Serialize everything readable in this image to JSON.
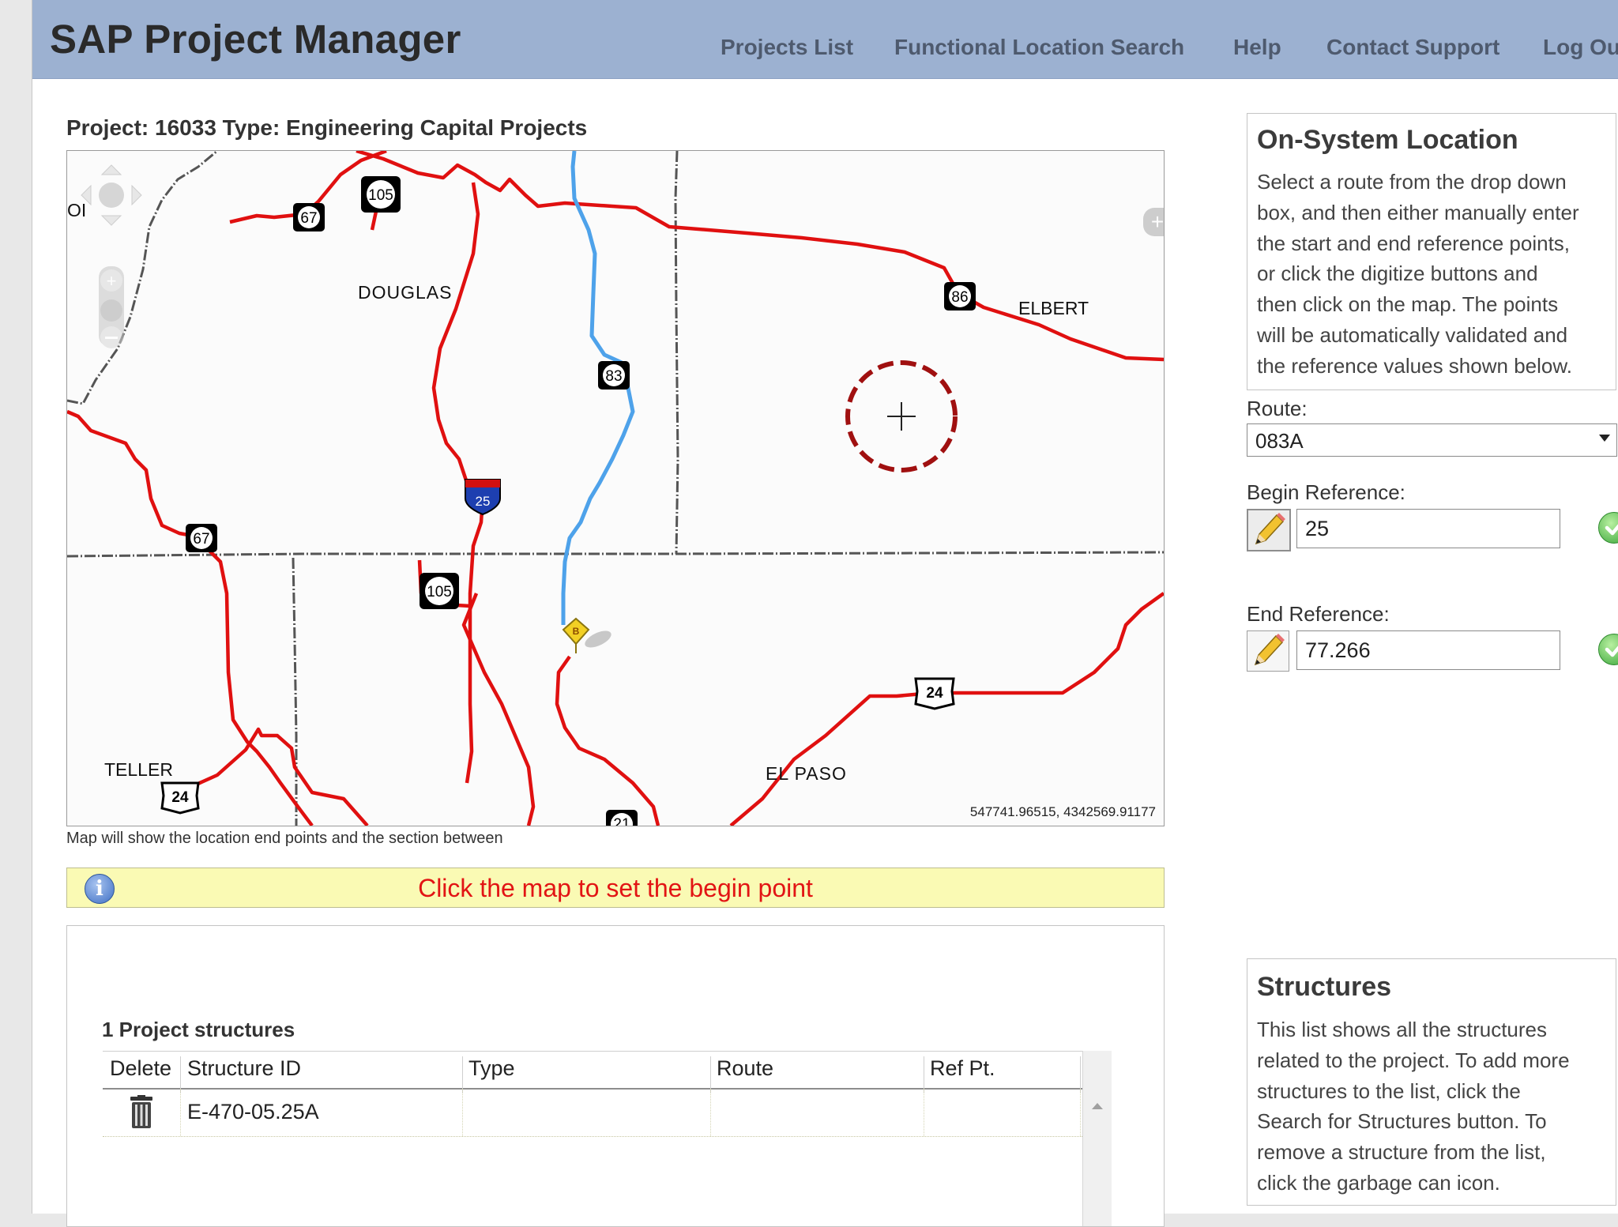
{
  "header": {
    "app_title": "SAP Project Manager",
    "nav": [
      "Projects List",
      "Functional Location Search",
      "Help",
      "Contact Support",
      "Log Ou"
    ]
  },
  "project": {
    "title": "Project: 16033 Type: Engineering Capital Projects"
  },
  "map": {
    "county_labels": [
      "DOUGLAS",
      "ELBERT",
      "TELLER",
      "EL PASO"
    ],
    "edge_label_left": "OI",
    "route_shields": [
      "105",
      "67",
      "86",
      "25",
      "67",
      "105",
      "24",
      "24",
      "21",
      "83"
    ],
    "begin_marker_label": "B",
    "coordinates": "547741.96515, 4342569.91177",
    "caption": "Map will show the location end points and the section between"
  },
  "info_bar": {
    "message": "Click the map to set the begin point"
  },
  "structures_table": {
    "count_label": "1 Project structures",
    "columns": [
      "Delete",
      "Structure ID",
      "Type",
      "Route",
      "Ref Pt."
    ],
    "rows": [
      {
        "structure_id": "E-470-05.25A",
        "type": "",
        "route": "",
        "ref_pt": ""
      }
    ]
  },
  "on_system_location": {
    "title": "On-System Location",
    "help_lines": [
      "Select a route from the drop down",
      "box, and then either manually enter",
      "the start and end reference points,",
      "or click the digitize buttons and",
      "then click on the map. The points",
      "will be automatically validated and",
      "the reference values shown below."
    ],
    "route_label": "Route:",
    "route_value": "083A",
    "begin_label": "Begin Reference:",
    "begin_value": "25",
    "end_label": "End Reference:",
    "end_value": "77.266"
  },
  "structures_box": {
    "title": "Structures",
    "help_lines": [
      "This list shows all the structures",
      "related to the project. To add more",
      "structures to the list, click the",
      "Search for Structures button. To",
      "remove a structure from the list,",
      "click the garbage can icon."
    ]
  },
  "colors": {
    "header_bg": "#9cb1d1",
    "road": "#e01010",
    "selected_route": "#4ea2ea",
    "info_bar_bg": "#fafab4",
    "info_text": "#e21414",
    "valid_check": "#3aa53a"
  },
  "icons": [
    "pan-control-icon",
    "zoom-in-icon",
    "zoom-out-icon",
    "expand-icon",
    "target-crosshair-icon",
    "begin-marker-icon",
    "info-icon",
    "pencil-icon",
    "check-icon",
    "trash-icon",
    "dropdown-caret-icon"
  ]
}
